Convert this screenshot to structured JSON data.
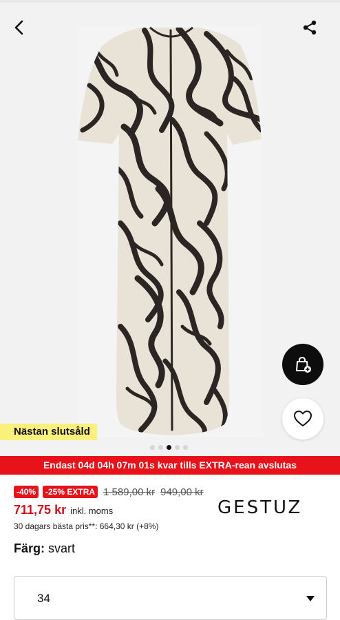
{
  "header": {
    "back_icon": "chevron-left-icon",
    "share_icon": "share-icon"
  },
  "gallery": {
    "image_count": 5,
    "active_index": 2,
    "badge": "Nästan slutsåld"
  },
  "actions": {
    "bag_icon": "shopping-bag-add-icon",
    "favorite_icon": "heart-icon"
  },
  "promo": {
    "text": "Endast 04d 04h 07m 01s kvar tills EXTRA-rean avslutas",
    "color": "#e8121b"
  },
  "price": {
    "discount_tag": "-40%",
    "extra_tag": "-25% EXTRA",
    "original_price": "1 589,00 kr",
    "previous_price": "949,00 kr",
    "current_price": "711,75 kr",
    "vat_note": "inkl. moms",
    "best_price_note": "30 dagars bästa pris**: 664,30 kr (+8%)"
  },
  "brand": {
    "name": "GESTUZ"
  },
  "color": {
    "label": "Färg:",
    "value": "svart"
  },
  "size": {
    "selected": "34"
  }
}
